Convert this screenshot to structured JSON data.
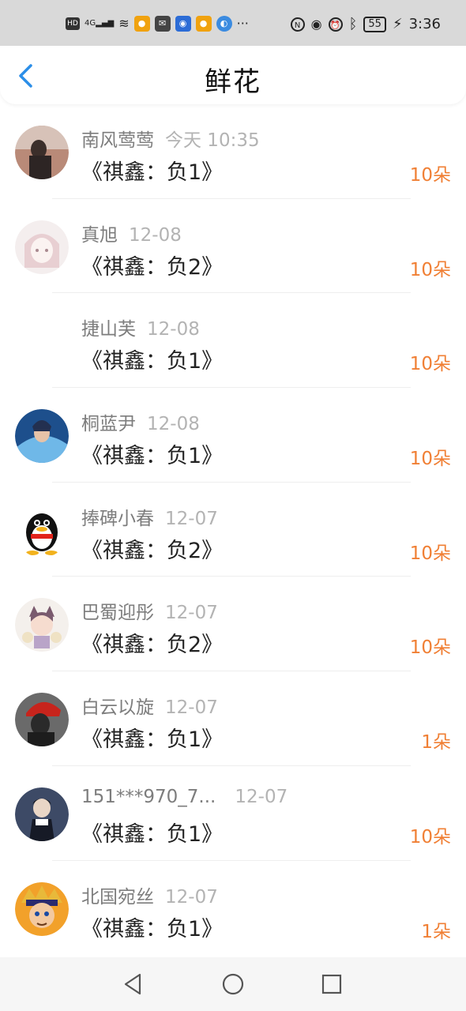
{
  "status_bar": {
    "hd_label": "HD",
    "network_label": "4G",
    "more_label": "···",
    "battery": "55",
    "time": "3:36",
    "icons": [
      "hd-icon",
      "signal-icon",
      "wifi-icon",
      "weibo-icon",
      "mail-icon",
      "app-icon",
      "weibo-icon",
      "browser-icon",
      "more-icon",
      "nfc-icon",
      "eye-icon",
      "alarm-icon",
      "bluetooth-icon",
      "battery-icon",
      "charging-icon"
    ]
  },
  "header": {
    "title": "鲜花",
    "back_icon": "chevron-left-icon",
    "accent_color": "#2b8ee8"
  },
  "colors": {
    "flower_count": "#f07f34",
    "name": "#7d7d7d",
    "date": "#b3b3b3"
  },
  "items": [
    {
      "name": "南风莺莺",
      "date": "今天 10:35",
      "book": "《祺鑫：负1》",
      "flowers": "10朵"
    },
    {
      "name": "真旭",
      "date": "12-08",
      "book": "《祺鑫：负2》",
      "flowers": "10朵"
    },
    {
      "name": "捷山芙",
      "date": "12-08",
      "book": "《祺鑫：负1》",
      "flowers": "10朵"
    },
    {
      "name": "桐蓝尹",
      "date": "12-08",
      "book": "《祺鑫：负1》",
      "flowers": "10朵"
    },
    {
      "name": "捧碑小春",
      "date": "12-07",
      "book": "《祺鑫：负2》",
      "flowers": "10朵"
    },
    {
      "name": "巴蜀迎彤",
      "date": "12-07",
      "book": "《祺鑫：负2》",
      "flowers": "10朵"
    },
    {
      "name": "白云以旋",
      "date": "12-07",
      "book": "《祺鑫：负1》",
      "flowers": "1朵"
    },
    {
      "name": "151***970_7...",
      "date": "12-07",
      "book": "《祺鑫：负1》",
      "flowers": "10朵"
    },
    {
      "name": "北国宛丝",
      "date": "12-07",
      "book": "《祺鑫：负1》",
      "flowers": "1朵"
    }
  ],
  "nav": {
    "back_icon": "triangle-back-icon",
    "home_icon": "circle-home-icon",
    "recent_icon": "square-recent-icon"
  }
}
